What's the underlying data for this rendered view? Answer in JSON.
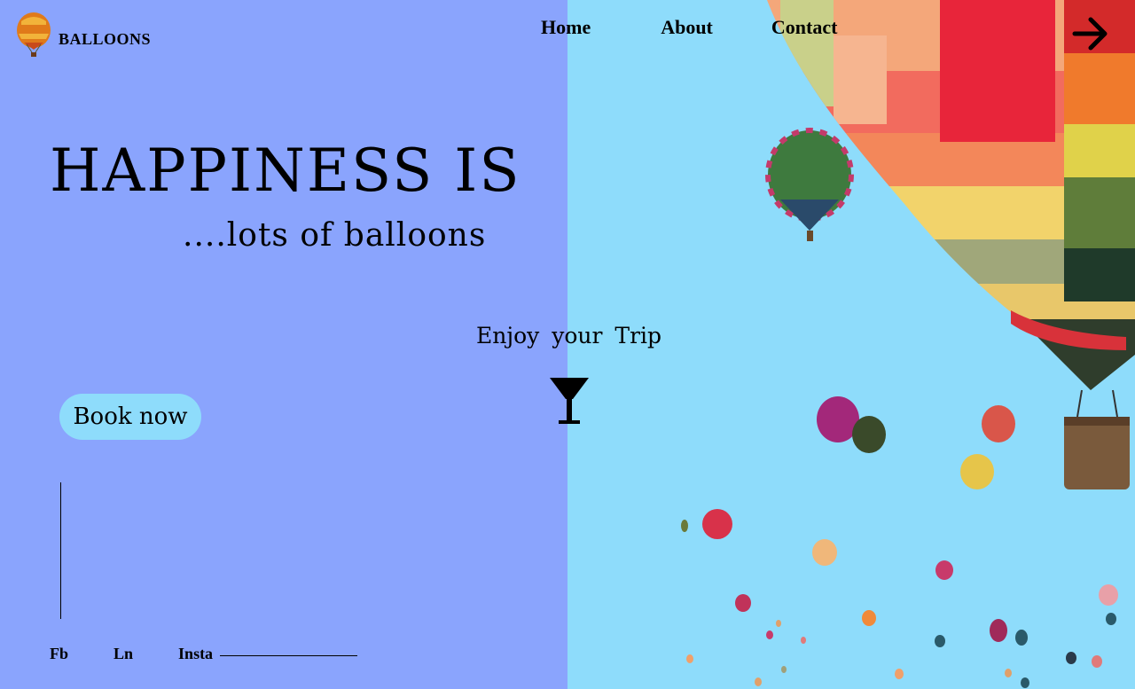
{
  "brand": {
    "name": "BALLOONS",
    "logo_icon": "hot-air-balloon-icon"
  },
  "nav": {
    "items": [
      {
        "label": "Home"
      },
      {
        "label": "About"
      },
      {
        "label": "Contact"
      }
    ],
    "menu_icon": "arrow-right-icon"
  },
  "hero": {
    "headline": "HAPPINESS IS",
    "subline": "....lots of balloons",
    "tagline": "Enjoy  your Trip",
    "tagline_icon": "cocktail-glass-icon",
    "cta_label": "Book now"
  },
  "socials": [
    {
      "label": "Fb"
    },
    {
      "label": "Ln"
    },
    {
      "label": "Insta"
    }
  ],
  "colors": {
    "left_panel": "#8aa4fd",
    "right_panel": "#8edcfb",
    "cta_background": "#8edcfb",
    "text": "#000000"
  }
}
